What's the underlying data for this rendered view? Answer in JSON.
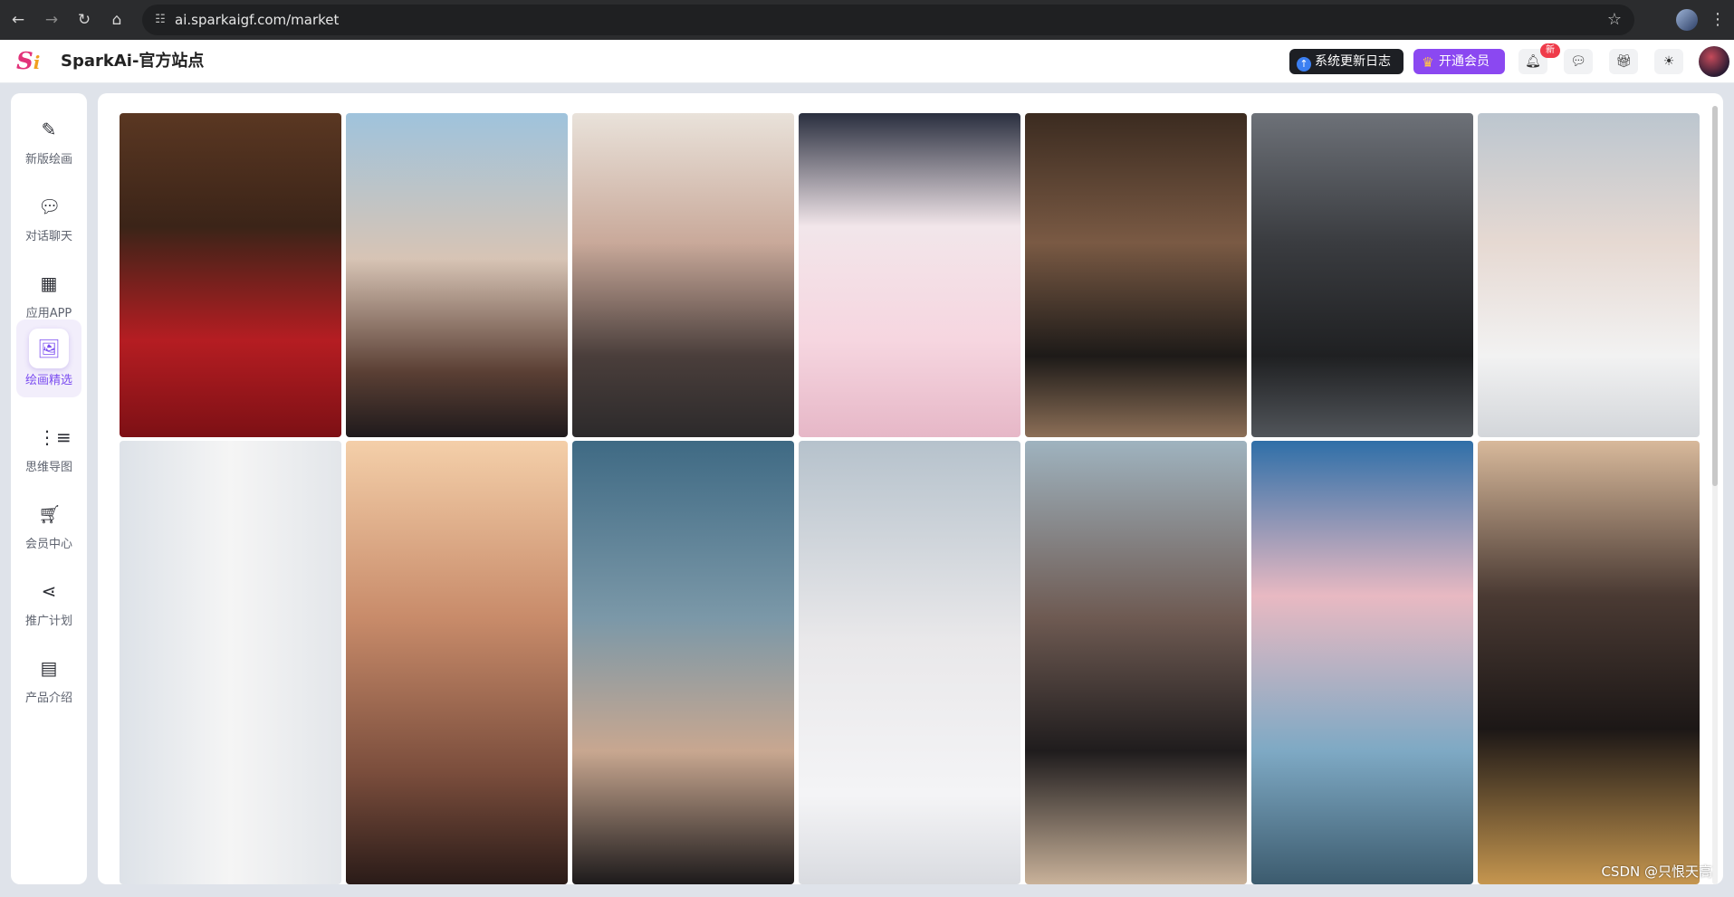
{
  "browser": {
    "url": "ai.sparkaigf.com/market",
    "back_icon": "arrow-left-icon",
    "forward_icon": "arrow-right-icon",
    "reload_icon": "reload-icon",
    "home_icon": "home-icon"
  },
  "header": {
    "logo_text": "S",
    "logo_text_2": "i",
    "title": "SparkAi-官方站点",
    "changelog_label": "系统更新日志",
    "vip_label": "开通会员",
    "notification_badge": "新",
    "accent_color": "#8b48f1"
  },
  "sidebar": {
    "items": [
      {
        "label": "新版绘画",
        "icon": "paint-brush-icon"
      },
      {
        "label": "对话聊天",
        "icon": "chat-bubble-icon"
      },
      {
        "label": "应用APP",
        "icon": "grid-apps-icon"
      },
      {
        "label": "绘画精选",
        "icon": "image-gallery-icon",
        "active": true
      },
      {
        "label": "思维导图",
        "icon": "mind-map-icon"
      },
      {
        "label": "会员中心",
        "icon": "cart-icon"
      },
      {
        "label": "推广计划",
        "icon": "share-icon"
      },
      {
        "label": "产品介绍",
        "icon": "product-box-icon"
      }
    ]
  },
  "gallery": {
    "columns": 7,
    "images": [
      {
        "alt": "woman in red dress"
      },
      {
        "alt": "woman hair blowing beach"
      },
      {
        "alt": "woman ponytail portrait"
      },
      {
        "alt": "anime girl white hair"
      },
      {
        "alt": "woman with glasses reading"
      },
      {
        "alt": "woman lying in sunlight"
      },
      {
        "alt": "woman white dress eyes closed"
      },
      {
        "alt": "woman white gown collage"
      },
      {
        "alt": "woman sunset portrait"
      },
      {
        "alt": "woman sea portrait"
      },
      {
        "alt": "woman white dress looking down"
      },
      {
        "alt": "woman at beach"
      },
      {
        "alt": "girl with parasol on pier"
      },
      {
        "alt": "witch in wheat field"
      }
    ]
  },
  "watermark": "CSDN @只恨天高"
}
